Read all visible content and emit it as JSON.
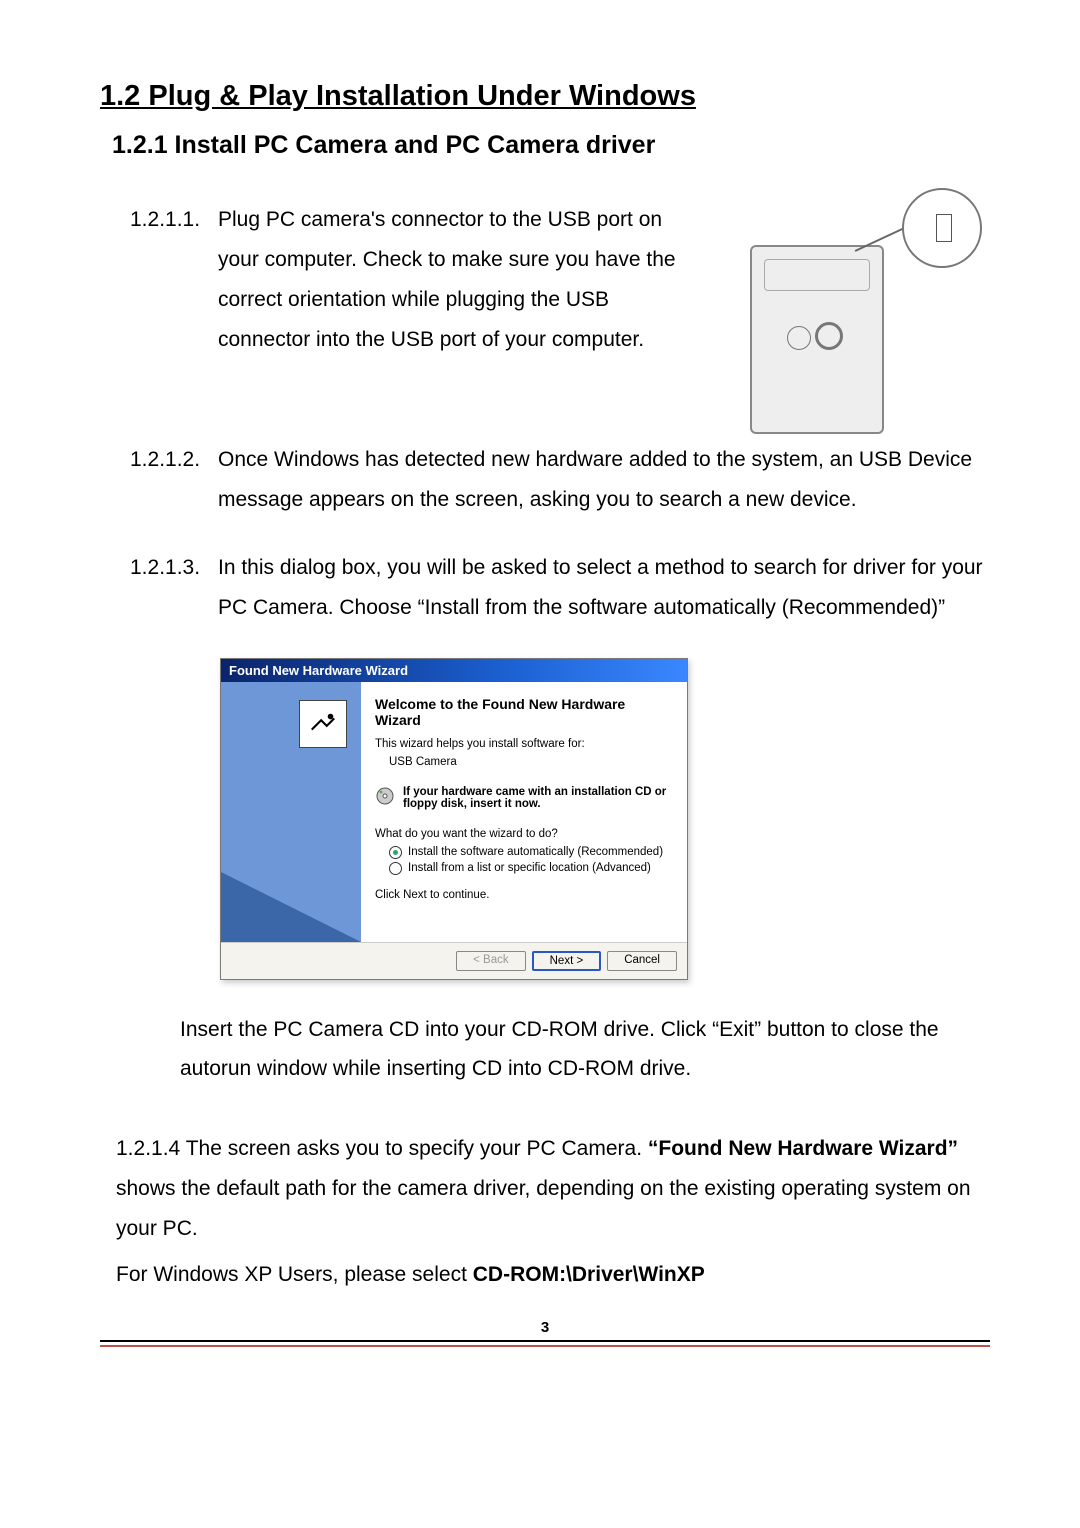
{
  "headings": {
    "h1": "1.2  Plug & Play Installation Under Windows",
    "h2": "1.2.1   Install PC Camera and PC Camera driver"
  },
  "steps": {
    "s1": {
      "num": "1.2.1.1.",
      "text": "Plug PC camera's connector to the USB port on your computer. Check to make sure you have the correct orientation while plugging the USB connector into the USB port of your computer."
    },
    "s2": {
      "num": "1.2.1.2.",
      "text": "Once Windows has detected new hardware added to the system, an USB Device message appears on the screen, asking you to search a new device."
    },
    "s3": {
      "num": "1.2.1.3.",
      "text": "In this dialog box, you will be asked to select a method to search for driver for your PC Camera. Choose “Install from the software automatically (Recommended)”"
    }
  },
  "wizard": {
    "title": "Found New Hardware Wizard",
    "welcome": "Welcome to the Found New Hardware Wizard",
    "helps": "This wizard helps you install software for:",
    "device": "USB Camera",
    "cd_hint": "If your hardware came with an installation CD or floppy disk, insert it now.",
    "question": "What do you want the wizard to do?",
    "opt_auto": "Install the software automatically (Recommended)",
    "opt_list": "Install from a list or specific location (Advanced)",
    "click_next": "Click Next to continue.",
    "btn_back": "< Back",
    "btn_next": "Next >",
    "btn_cancel": "Cancel"
  },
  "cd_note": "Insert the PC Camera CD into your CD-ROM drive. Click “Exit” button to close the autorun window while inserting CD into CD-ROM drive.",
  "s4": {
    "num": "1.2.1.4",
    "lead1": " The screen asks you to specify your PC Camera. ",
    "bold1": "“Found New Hardware Wizard”",
    "rest1": " shows the default path for the camera driver, depending on the existing operating system on your PC.",
    "line2a": "For Windows XP Users, please select ",
    "bold2": "CD-ROM:\\Driver\\WinXP"
  },
  "page_number": "3"
}
